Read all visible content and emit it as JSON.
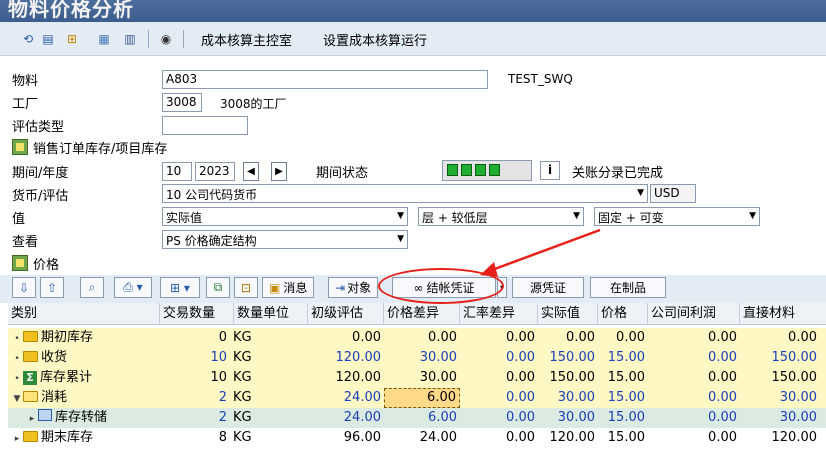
{
  "window": {
    "title": "物料价格分析"
  },
  "toolbar": {
    "icons": [
      "refresh-icon",
      "grid-icon",
      "hierarchy-icon",
      "table-icon",
      "layout-icon",
      "info-icon"
    ],
    "links": [
      "成本核算主控室",
      "设置成本核算运行"
    ]
  },
  "form": {
    "material_label": "物料",
    "material_value": "A803",
    "material_desc": "TEST_SWQ",
    "plant_label": "工厂",
    "plant_value": "3008",
    "plant_desc": "3008的工厂",
    "valuation_type_label": "评估类型",
    "valuation_type_value": "",
    "sales_order_stock_label": "销售订单库存/项目库存",
    "period_label": "期间/年度",
    "period_value": "10",
    "year_value": "2023",
    "period_status_label": "期间状态",
    "period_status_text": "关账分录已完成",
    "currency_label": "货币/评估",
    "currency_value": "10 公司代码货币",
    "currency_code": "USD",
    "value_label": "值",
    "value_value": "实际值",
    "level_value": "层 + 较低层",
    "fixed_value": "固定 + 可变",
    "view_label": "查看",
    "view_value": "PS 价格确定结构",
    "price_section_label": "价格"
  },
  "alv_toolbar": {
    "buttons": [
      "消息",
      "对象",
      "结帐凭证",
      "源凭证",
      "在制品"
    ]
  },
  "grid": {
    "columns": [
      "类别",
      "交易数量",
      "数量单位",
      "初级评估",
      "价格差异",
      "汇率差异",
      "实际值",
      "价格",
      "公司间利润",
      "直接材料"
    ],
    "rows": [
      {
        "expander": "•",
        "icon": "folder-icon",
        "name": "期初库存",
        "qty": "0",
        "unit": "KG",
        "prim": "0.00",
        "pdiff": "0.00",
        "exdiff": "0.00",
        "actual": "0.00",
        "price": "0.00",
        "ic": "0.00",
        "dm": "0.00"
      },
      {
        "expander": "•",
        "icon": "folder-icon",
        "name": "收货",
        "qty": "10",
        "unit": "KG",
        "prim": "120.00",
        "pdiff": "30.00",
        "exdiff": "0.00",
        "actual": "150.00",
        "price": "15.00",
        "ic": "0.00",
        "dm": "150.00"
      },
      {
        "expander": "•",
        "icon": "sigma-icon",
        "name": "库存累计",
        "qty": "10",
        "unit": "KG",
        "prim": "120.00",
        "pdiff": "30.00",
        "exdiff": "0.00",
        "actual": "150.00",
        "price": "15.00",
        "ic": "0.00",
        "dm": "150.00"
      },
      {
        "expander": "▼",
        "icon": "folder-open-icon",
        "name": "消耗",
        "qty": "2",
        "unit": "KG",
        "prim": "24.00",
        "pdiff": "6.00",
        "exdiff": "0.00",
        "actual": "30.00",
        "price": "15.00",
        "ic": "0.00",
        "dm": "30.00"
      },
      {
        "expander": "▸",
        "icon": "transfer-icon",
        "name": "库存转储",
        "qty": "2",
        "unit": "KG",
        "prim": "24.00",
        "pdiff": "6.00",
        "exdiff": "0.00",
        "actual": "30.00",
        "price": "15.00",
        "ic": "0.00",
        "dm": "30.00"
      },
      {
        "expander": "▸",
        "icon": "folder-icon",
        "name": "期末库存",
        "qty": "8",
        "unit": "KG",
        "prim": "96.00",
        "pdiff": "24.00",
        "exdiff": "0.00",
        "actual": "120.00",
        "price": "15.00",
        "ic": "0.00",
        "dm": "120.00"
      }
    ]
  },
  "colors": {
    "row_highlight": "#fff8c4",
    "row_selected": "#dcebe2",
    "cell_focus": "#ffd98a",
    "annotation": "#e8201a",
    "status_green": "#1fae30"
  }
}
